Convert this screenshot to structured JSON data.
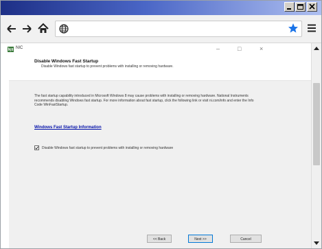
{
  "browser": {
    "url": "",
    "colors": {
      "titlebar_start": "#1d2f86",
      "titlebar_end": "#aebff0",
      "star": "#1a73e8"
    },
    "icons": [
      "back-arrow-icon",
      "forward-arrow-icon",
      "home-icon",
      "globe-icon",
      "star-icon",
      "menu-icon"
    ]
  },
  "installer": {
    "window_title": "NIC",
    "header": {
      "title": "Disable Windows Fast Startup",
      "subtitle": "Disable Windows fast startup to prevent problems with installing or removing hardware."
    },
    "body": {
      "description": "The fast startup capability introduced in Microsoft Windows 8 may cause problems with installing or removing hardware. National Instruments recommends disabling Windows fast startup. For more information about fast startup, click the following link or visit ni.com/info and enter the Info Code WinFastStartup.",
      "link_text": "Windows Fast Startup Information",
      "checkbox_label": "Disable Windows fast startup to prevent problems with installing or removing hardware",
      "checkbox_checked": true
    },
    "buttons": {
      "back": "<< Back",
      "next": "Next >>",
      "cancel": "Cancel"
    }
  }
}
